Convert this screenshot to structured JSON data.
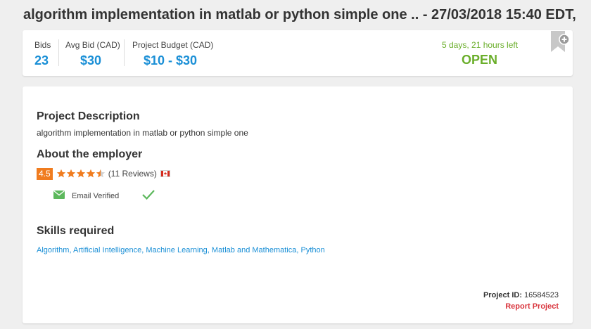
{
  "page": {
    "title": "algorithm implementation in matlab or python simple one .. - 27/03/2018 15:40 EDT,"
  },
  "summary": {
    "bids_label": "Bids",
    "bids_value": "23",
    "avg_bid_label": "Avg Bid (CAD)",
    "avg_bid_value": "$30",
    "budget_label": "Project Budget (CAD)",
    "budget_value": "$10 - $30",
    "time_left": "5 days, 21 hours left",
    "status": "OPEN"
  },
  "details": {
    "description_heading": "Project Description",
    "description": "algorithm implementation in matlab or python simple one",
    "employer_heading": "About the employer",
    "rating": "4.5",
    "rating_value": 4.5,
    "reviews": "(11 Reviews)",
    "email_verified": "Email Verified",
    "skills_heading": "Skills required",
    "skills": [
      "Algorithm",
      "Artificial Intelligence",
      "Machine Learning",
      "Matlab and Mathematica",
      "Python"
    ],
    "project_id_label": "Project ID:",
    "project_id": "16584523",
    "report": "Report Project"
  },
  "colors": {
    "accent_blue": "#1a8fd6",
    "status_green": "#6aae2a",
    "rating_orange": "#f07c1f",
    "report_red": "#d9363e"
  },
  "icons": [
    "bookmark-add-icon",
    "star-icon",
    "canada-flag-icon",
    "email-icon",
    "checkmark-icon"
  ]
}
